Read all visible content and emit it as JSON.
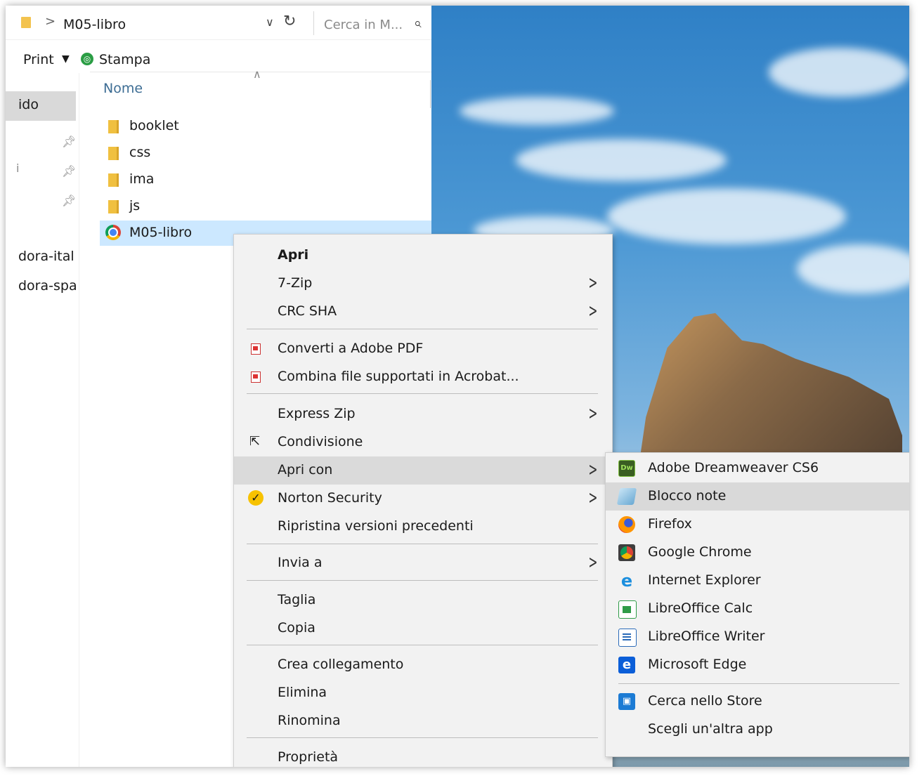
{
  "explorer": {
    "address_separator": ">",
    "address_path": "M05-libro",
    "search_placeholder": "Cerca in M...",
    "toolbar": {
      "print_label": "Print",
      "stampa_label": "Stampa"
    },
    "column_header": "Nome",
    "nav": {
      "quick_access_label": "ido",
      "item_i": "i",
      "items": [
        "dora-ital",
        "dora-spa"
      ]
    },
    "files": [
      {
        "name": "booklet",
        "type": "folder"
      },
      {
        "name": "css",
        "type": "folder"
      },
      {
        "name": "ima",
        "type": "folder"
      },
      {
        "name": "js",
        "type": "folder"
      },
      {
        "name": "M05-libro",
        "type": "chrome-html",
        "selected": true
      }
    ]
  },
  "context_menu": {
    "items": [
      {
        "label": "Apri",
        "bold": true
      },
      {
        "label": "7-Zip",
        "submenu": true
      },
      {
        "label": "CRC SHA",
        "submenu": true
      },
      {
        "label": "Converti a Adobe PDF",
        "icon": "pdf-icon"
      },
      {
        "label": "Combina file supportati in Acrobat...",
        "icon": "acrobat-icon"
      },
      {
        "label": "Express Zip",
        "submenu": true
      },
      {
        "label": "Condivisione",
        "icon": "share-icon"
      },
      {
        "label": "Apri con",
        "submenu": true,
        "highlighted": true
      },
      {
        "label": "Norton Security",
        "icon": "norton-icon",
        "submenu": true
      },
      {
        "label": "Ripristina versioni precedenti"
      },
      {
        "label": "Invia a",
        "submenu": true
      },
      {
        "label": "Taglia"
      },
      {
        "label": "Copia"
      },
      {
        "label": "Crea collegamento"
      },
      {
        "label": "Elimina"
      },
      {
        "label": "Rinomina"
      },
      {
        "label": "Proprietà"
      }
    ]
  },
  "open_with_submenu": {
    "items": [
      {
        "label": "Adobe Dreamweaver CS6",
        "icon": "dreamweaver-icon",
        "icon_text": "Dw"
      },
      {
        "label": "Blocco note",
        "icon": "notepad-icon",
        "highlighted": true
      },
      {
        "label": "Firefox",
        "icon": "firefox-icon"
      },
      {
        "label": "Google Chrome",
        "icon": "chrome-icon"
      },
      {
        "label": "Internet Explorer",
        "icon": "ie-icon"
      },
      {
        "label": "LibreOffice Calc",
        "icon": "calc-icon"
      },
      {
        "label": "LibreOffice Writer",
        "icon": "writer-icon"
      },
      {
        "label": "Microsoft Edge",
        "icon": "edge-icon"
      },
      {
        "label": "Cerca nello Store",
        "icon": "store-icon"
      },
      {
        "label": "Scegli un'altra app"
      }
    ]
  },
  "colors": {
    "selection": "#cce8ff",
    "menu_bg": "#f2f2f2",
    "menu_highlight": "#dadada",
    "folder": "#f0c040",
    "header_text": "#3d6d94"
  }
}
